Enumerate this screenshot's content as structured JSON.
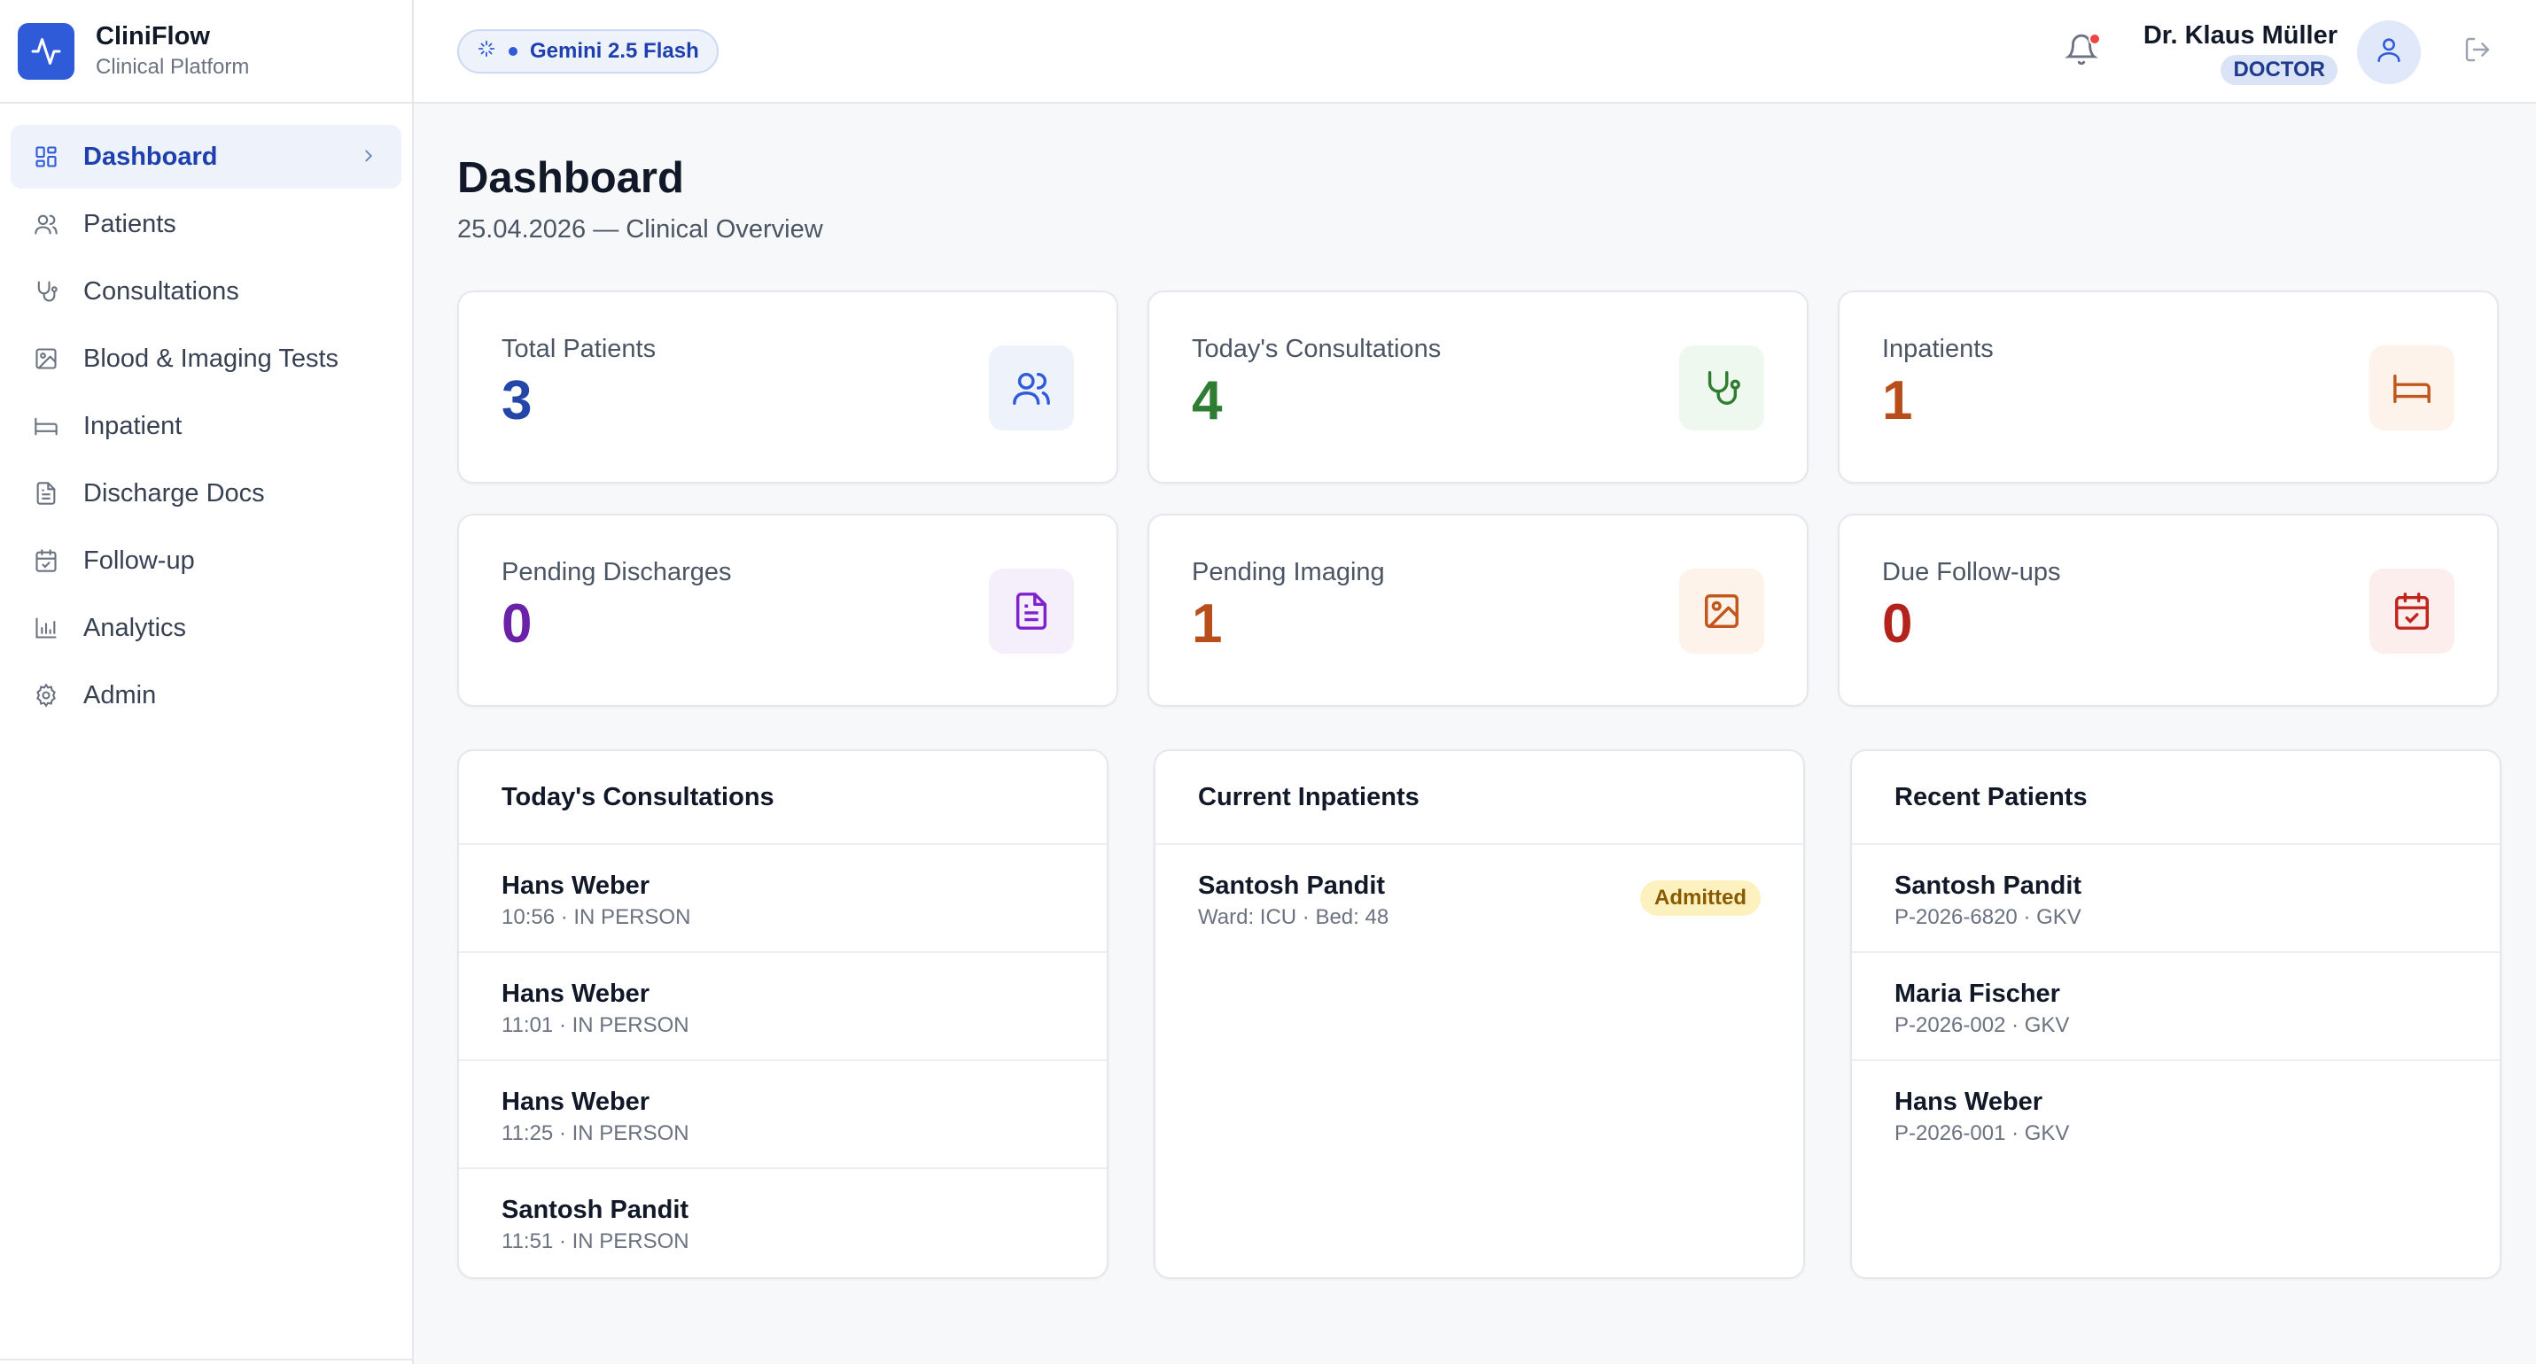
{
  "brand": {
    "name": "CliniFlow",
    "subtitle": "Clinical Platform",
    "icon": "activity-icon",
    "color": "#2f5bd8"
  },
  "sidebar": {
    "items": [
      {
        "label": "Dashboard",
        "icon": "grid-icon",
        "active": true
      },
      {
        "label": "Patients",
        "icon": "users-icon"
      },
      {
        "label": "Consultations",
        "icon": "stethoscope-icon"
      },
      {
        "label": "Blood & Imaging Tests",
        "icon": "image-icon"
      },
      {
        "label": "Inpatient",
        "icon": "bed-icon"
      },
      {
        "label": "Discharge Docs",
        "icon": "file-text-icon"
      },
      {
        "label": "Follow-up",
        "icon": "calendar-check-icon"
      },
      {
        "label": "Analytics",
        "icon": "bar-chart-icon"
      },
      {
        "label": "Admin",
        "icon": "gear-icon"
      }
    ]
  },
  "topbar": {
    "model": "Gemini 2.5 Flash",
    "user_name": "Dr. Klaus Müller",
    "role": "DOCTOR"
  },
  "page": {
    "title": "Dashboard",
    "subtitle": "25.04.2026 — Clinical Overview"
  },
  "stats": [
    {
      "label": "Total Patients",
      "value": "3",
      "color": "#2446a8",
      "icon": "users-icon",
      "icon_bg": "#eef2fb",
      "icon_color": "#2f5bd8"
    },
    {
      "label": "Today's Consultations",
      "value": "4",
      "color": "#2e7d32",
      "icon": "stethoscope-icon",
      "icon_bg": "#eef8ef",
      "icon_color": "#2e7d32"
    },
    {
      "label": "Inpatients",
      "value": "1",
      "color": "#b84e1c",
      "icon": "bed-icon",
      "icon_bg": "#fdf3ea",
      "icon_color": "#c2571d"
    },
    {
      "label": "Pending Discharges",
      "value": "0",
      "color": "#6b21a8",
      "icon": "file-text-icon",
      "icon_bg": "#f5effb",
      "icon_color": "#7e22ce"
    },
    {
      "label": "Pending Imaging",
      "value": "1",
      "color": "#b84e1c",
      "icon": "image-icon",
      "icon_bg": "#fdf3ea",
      "icon_color": "#c2571d"
    },
    {
      "label": "Due Follow-ups",
      "value": "0",
      "color": "#b4231b",
      "icon": "calendar-check-icon",
      "icon_bg": "#fdeeee",
      "icon_color": "#c0261d"
    }
  ],
  "panels": {
    "consultations": {
      "title": "Today's Consultations",
      "rows": [
        {
          "name": "Hans Weber",
          "detail": "10:56 · IN PERSON"
        },
        {
          "name": "Hans Weber",
          "detail": "11:01 · IN PERSON"
        },
        {
          "name": "Hans Weber",
          "detail": "11:25 · IN PERSON"
        },
        {
          "name": "Santosh Pandit",
          "detail": "11:51 · IN PERSON"
        }
      ]
    },
    "inpatients": {
      "title": "Current Inpatients",
      "rows": [
        {
          "name": "Santosh Pandit",
          "detail": "Ward: ICU · Bed: 48",
          "status": "Admitted"
        }
      ]
    },
    "recent": {
      "title": "Recent Patients",
      "rows": [
        {
          "name": "Santosh Pandit",
          "detail": "P-2026-6820 · GKV"
        },
        {
          "name": "Maria Fischer",
          "detail": "P-2026-002 · GKV"
        },
        {
          "name": "Hans Weber",
          "detail": "P-2026-001 · GKV"
        }
      ]
    }
  }
}
